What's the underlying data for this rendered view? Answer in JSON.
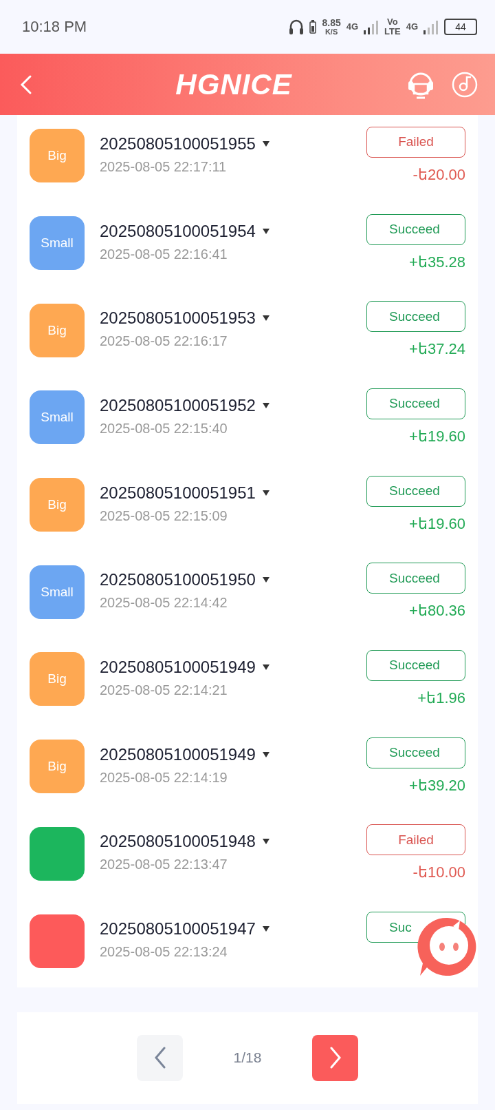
{
  "status_bar": {
    "time": "10:18 PM",
    "speed": "8.85",
    "speed_unit": "K/S",
    "net1": "4G",
    "volte_top": "Vo",
    "volte_bottom": "LTE",
    "net2": "4G",
    "battery": "44"
  },
  "header": {
    "logo": "HGNICE"
  },
  "rows": [
    {
      "badge": {
        "label": "Big",
        "color": "#fea852"
      },
      "order": "20250805100051955",
      "time": "2025-08-05 22:17:11",
      "status": {
        "kind": "failed",
        "label": "Failed"
      },
      "amount": "-ե20.00"
    },
    {
      "badge": {
        "label": "Small",
        "color": "#6ca6f2"
      },
      "order": "20250805100051954",
      "time": "2025-08-05 22:16:41",
      "status": {
        "kind": "succeed",
        "label": "Succeed"
      },
      "amount": "+ե35.28"
    },
    {
      "badge": {
        "label": "Big",
        "color": "#fea852"
      },
      "order": "20250805100051953",
      "time": "2025-08-05 22:16:17",
      "status": {
        "kind": "succeed",
        "label": "Succeed"
      },
      "amount": "+ե37.24"
    },
    {
      "badge": {
        "label": "Small",
        "color": "#6ca6f2"
      },
      "order": "20250805100051952",
      "time": "2025-08-05 22:15:40",
      "status": {
        "kind": "succeed",
        "label": "Succeed"
      },
      "amount": "+ե19.60"
    },
    {
      "badge": {
        "label": "Big",
        "color": "#fea852"
      },
      "order": "20250805100051951",
      "time": "2025-08-05 22:15:09",
      "status": {
        "kind": "succeed",
        "label": "Succeed"
      },
      "amount": "+ե19.60"
    },
    {
      "badge": {
        "label": "Small",
        "color": "#6ca6f2"
      },
      "order": "20250805100051950",
      "time": "2025-08-05 22:14:42",
      "status": {
        "kind": "succeed",
        "label": "Succeed"
      },
      "amount": "+ե80.36"
    },
    {
      "badge": {
        "label": "Big",
        "color": "#fea852"
      },
      "order": "20250805100051949",
      "time": "2025-08-05 22:14:21",
      "status": {
        "kind": "succeed",
        "label": "Succeed"
      },
      "amount": "+ե1.96"
    },
    {
      "badge": {
        "label": "Big",
        "color": "#fea852"
      },
      "order": "20250805100051949",
      "time": "2025-08-05 22:14:19",
      "status": {
        "kind": "succeed",
        "label": "Succeed"
      },
      "amount": "+ե39.20"
    },
    {
      "badge": {
        "color": "#1cb65d"
      },
      "order": "20250805100051948",
      "time": "2025-08-05 22:13:47",
      "status": {
        "kind": "failed",
        "label": "Failed"
      },
      "amount": "-ե10.00"
    },
    {
      "badge": {
        "color": "#fd5a5a"
      },
      "order": "20250805100051947",
      "time": "2025-08-05 22:13:24",
      "status": {
        "kind": "succeed",
        "label": "Suc"
      }
    }
  ],
  "pagination": {
    "page": "1/18",
    "prev_disabled": true
  }
}
